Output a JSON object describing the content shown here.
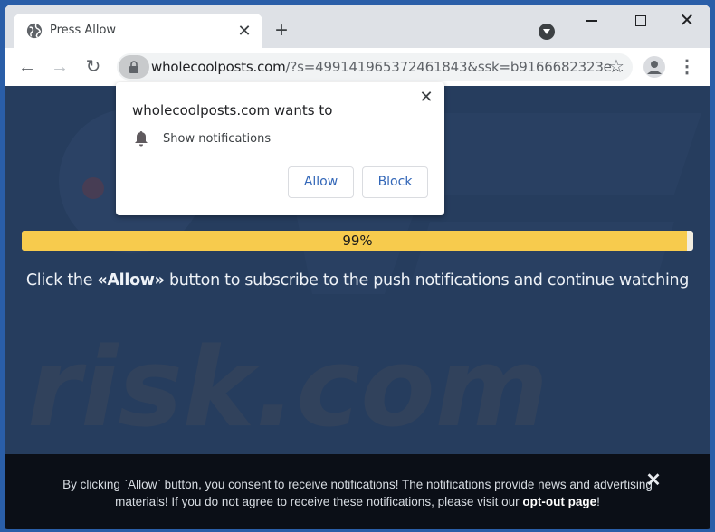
{
  "browser": {
    "tab": {
      "title": "Press Allow",
      "favicon": "globe-icon",
      "close_glyph": "✕"
    },
    "new_tab_glyph": "+",
    "window_controls": {
      "close_glyph": "✕"
    },
    "nav": {
      "back_glyph": "←",
      "forward_glyph": "→",
      "reload_glyph": "↻"
    },
    "address_bar": {
      "host": "wholecoolposts.com",
      "path": "/?s=499141965372461843&ssk=b9166682323e..."
    },
    "bookmark_glyph": "☆",
    "menu_glyph": "⋮"
  },
  "permission_popup": {
    "title": "wholecoolposts.com wants to",
    "permission": "Show notifications",
    "close_glyph": "✕",
    "allow_label": "Allow",
    "block_label": "Block"
  },
  "page": {
    "progress": {
      "percent": 99,
      "label": "99%"
    },
    "headline": {
      "before": "Click the ",
      "bold": "«Allow»",
      "after": " button to subscribe to the push notifications and continue watching"
    },
    "watermark_text": "risk.com",
    "consent": {
      "text_before": "By clicking `Allow` button, you consent to receive notifications! The notifications provide news and advertising materials! If you do not agree to receive these notifications, please visit our ",
      "link_label": "opt-out page",
      "text_after": "!",
      "close_glyph": "✕"
    }
  }
}
